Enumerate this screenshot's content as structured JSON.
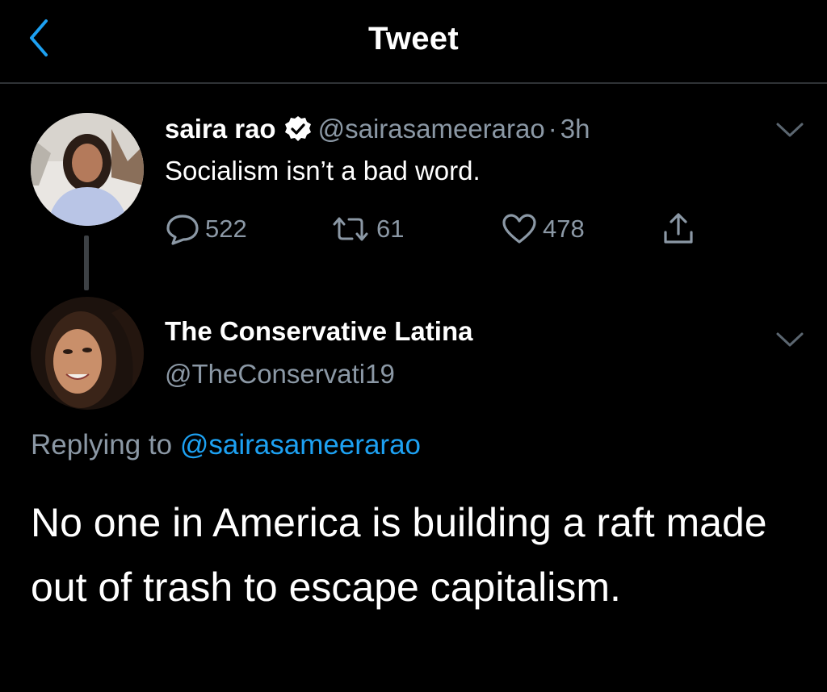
{
  "header": {
    "title": "Tweet",
    "back_icon": "chevron-left-icon",
    "accent": "#1da1f2"
  },
  "parent_tweet": {
    "display_name": "saira rao",
    "verified": true,
    "handle": "@sairasameerarao",
    "separator": "·",
    "time": "3h",
    "text": "Socialism isn’t a bad word.",
    "replies": "522",
    "retweets": "61",
    "likes": "478"
  },
  "reply_tweet": {
    "display_name": "The Conservative Latina",
    "handle": "@TheConservati19",
    "replying_prefix": "Replying to",
    "replying_to": "@sairasameerarao",
    "text": "No one in America is building a raft made out of trash to escape capitalism."
  },
  "colors": {
    "background": "#000000",
    "muted": "#8b98a5",
    "link": "#1da1f2"
  }
}
